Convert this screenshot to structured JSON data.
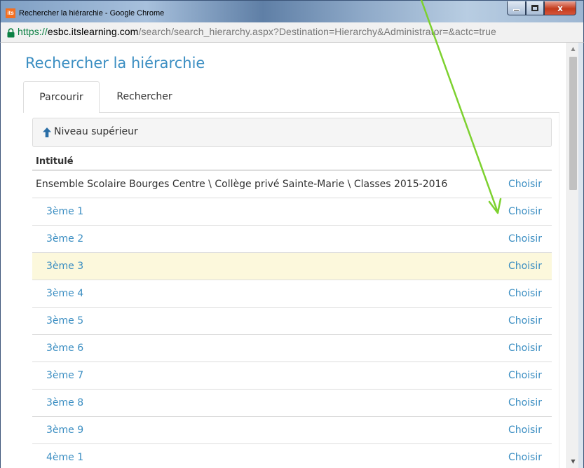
{
  "window": {
    "app_icon_text": "its",
    "title": "Rechercher la hiérarchie - Google Chrome",
    "minimize_symbol": "—",
    "close_symbol": "x"
  },
  "address": {
    "scheme": "https://",
    "host": "esbc.itslearning.com",
    "path": "/search/search_hierarchy.aspx?Destination=Hierarchy&Administrator=&actc=true"
  },
  "page": {
    "title": "Rechercher la hiérarchie"
  },
  "tabs": [
    {
      "label": "Parcourir",
      "active": true
    },
    {
      "label": "Rechercher",
      "active": false
    }
  ],
  "up_level": {
    "label": "Niveau supérieur"
  },
  "table": {
    "column_header": "Intitulé",
    "parent": {
      "label": "Ensemble Scolaire Bourges Centre \\ Collège privé Sainte-Marie \\ Classes 2015-2016",
      "action": "Choisir"
    },
    "rows": [
      {
        "label": "3ème 1",
        "action": "Choisir"
      },
      {
        "label": "3ème 2",
        "action": "Choisir"
      },
      {
        "label": "3ème 3",
        "action": "Choisir",
        "highlighted": true
      },
      {
        "label": "3ème 4",
        "action": "Choisir"
      },
      {
        "label": "3ème 5",
        "action": "Choisir"
      },
      {
        "label": "3ème 6",
        "action": "Choisir"
      },
      {
        "label": "3ème 7",
        "action": "Choisir"
      },
      {
        "label": "3ème 8",
        "action": "Choisir"
      },
      {
        "label": "3ème 9",
        "action": "Choisir"
      },
      {
        "label": "4ème 1",
        "action": "Choisir"
      }
    ]
  },
  "colors": {
    "link": "#3b8ec2",
    "highlight_row": "#fcf8dc",
    "annotation_arrow": "#7dd12f",
    "secure_green": "#0b8043"
  },
  "icons": {
    "lock": "lock-icon",
    "up": "arrow-up-icon",
    "scroll_up": "chevron-up-icon",
    "scroll_down": "chevron-down-icon"
  }
}
